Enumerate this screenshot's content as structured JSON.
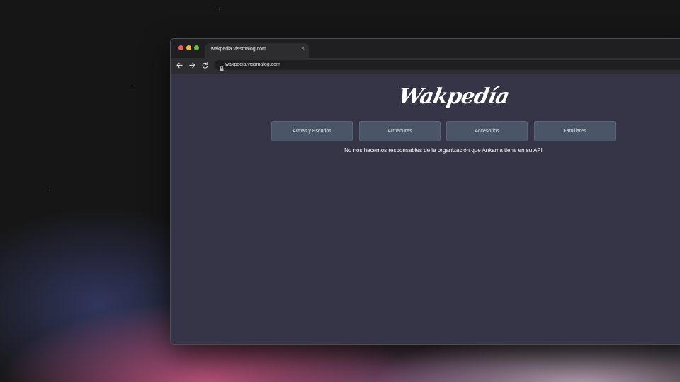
{
  "colors": {
    "desktop_bg": "#161616",
    "page_bg": "#363447",
    "card_bg": "#4a5568",
    "titlebar_bg": "#1f1f21",
    "toolbar_bg": "#2d2d30"
  },
  "browser": {
    "tab": {
      "title": "wakpedia.vissmalog.com",
      "close_icon": "close-icon",
      "close_glyph": "×"
    },
    "toolbar": {
      "back_icon": "arrow-left-icon",
      "forward_icon": "arrow-right-icon",
      "reload_icon": "reload-icon",
      "lock_icon": "lock-icon",
      "url": "wakpedia.vissmalog.com"
    }
  },
  "page": {
    "logo": "Wakpedía",
    "nav_cards": [
      {
        "label": "Armas y Escudos"
      },
      {
        "label": "Armaduras"
      },
      {
        "label": "Accesorios"
      },
      {
        "label": "Familiares"
      }
    ],
    "disclaimer": "No nos hacemos responsables de la organización que Ankama tiene en su API"
  }
}
